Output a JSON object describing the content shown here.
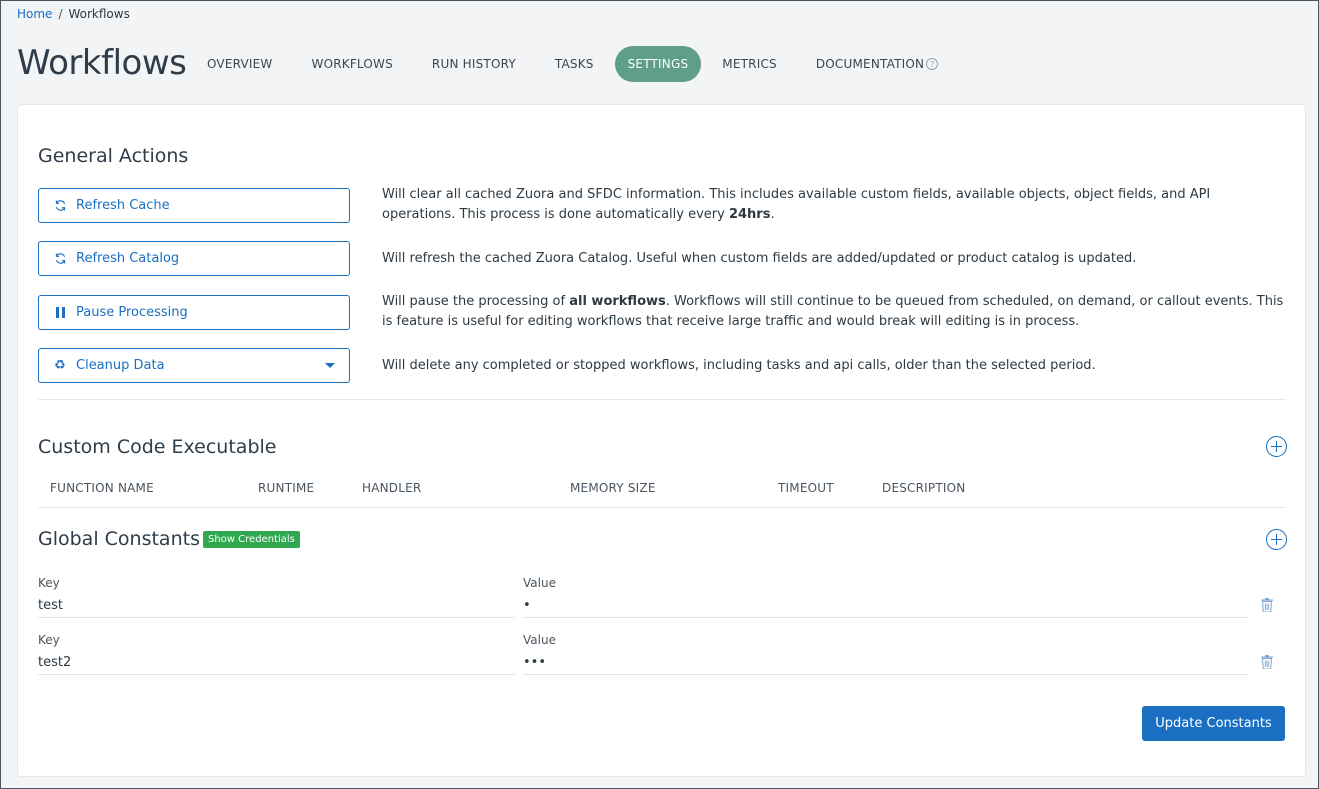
{
  "breadcrumb": {
    "home": "Home",
    "separator": "/",
    "current": "Workflows"
  },
  "page": {
    "title": "Workflows"
  },
  "tabs": [
    {
      "label": "OVERVIEW"
    },
    {
      "label": "WORKFLOWS"
    },
    {
      "label": "RUN HISTORY"
    },
    {
      "label": "TASKS"
    },
    {
      "label": "SETTINGS",
      "active": true
    },
    {
      "label": "METRICS"
    },
    {
      "label": "DOCUMENTATION",
      "info_icon": "?"
    }
  ],
  "general_actions": {
    "title": "General Actions",
    "actions": [
      {
        "label": "Refresh Cache",
        "icon": "refresh-icon",
        "desc_parts": [
          "Will clear all cached Zuora and SFDC information. This includes available custom fields, available objects, object fields, and API operations. This process is done automatically every ",
          "24hrs",
          "."
        ]
      },
      {
        "label": "Refresh Catalog",
        "icon": "refresh-icon",
        "desc": "Will refresh the cached Zuora Catalog. Useful when custom fields are added/updated or product catalog is updated."
      },
      {
        "label": "Pause Processing",
        "icon": "pause-icon",
        "desc_parts": [
          "Will pause the processing of ",
          "all workflows",
          ". Workflows will still continue to be queued from scheduled, on demand, or callout events. This is feature is useful for editing workflows that receive large traffic and would break will editing is in process."
        ]
      },
      {
        "label": "Cleanup Data",
        "icon": "recycle-icon",
        "desc": "Will delete any completed or stopped workflows, including tasks and api calls, older than the selected period."
      }
    ]
  },
  "custom_code": {
    "title": "Custom Code Executable",
    "columns": [
      "FUNCTION NAME",
      "RUNTIME",
      "HANDLER",
      "MEMORY SIZE",
      "TIMEOUT",
      "DESCRIPTION"
    ]
  },
  "global_constants": {
    "title": "Global Constants",
    "show_credentials": "Show Credentials",
    "key_label": "Key",
    "value_label": "Value",
    "rows": [
      {
        "key": "test",
        "value": "•"
      },
      {
        "key": "test2",
        "value": "•••"
      }
    ],
    "update_button": "Update Constants"
  },
  "colors": {
    "accent": "#1a6fc2",
    "active_tab": "#5f9f8a",
    "badge": "#2fa84f"
  }
}
